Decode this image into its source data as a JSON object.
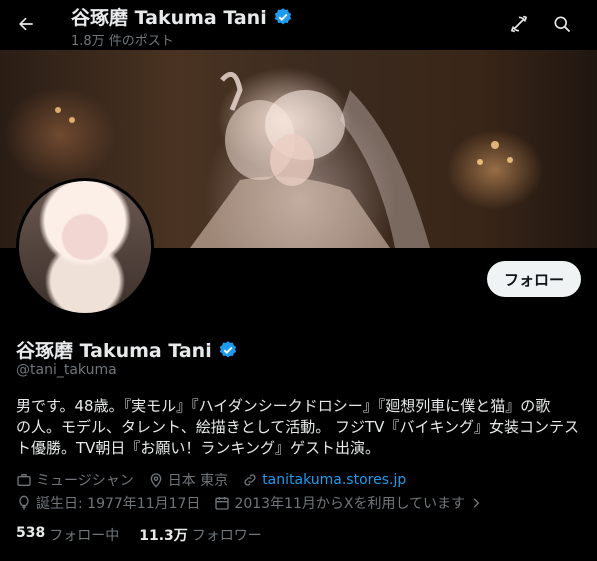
{
  "header": {
    "name": "谷琢磨 Takuma Tani",
    "post_count": "1.8万 件のポスト"
  },
  "profile": {
    "name": "谷琢磨 Takuma Tani",
    "handle": "@tani_takuma",
    "follow_label": "フォロー",
    "bio_lines": [
      "男です。48歳。『実モル』『ハイダンシークドロシー』『廻想列車に僕と猫』の歌",
      "の人。モデル、タレント、絵描きとして活動。 フジTV『バイキング』女装コンテス",
      "ト優勝。TV朝日『お願い！ランキング』ゲスト出演。"
    ],
    "category": "ミュージシャン",
    "location": "日本 東京",
    "website": "tanitakuma.stores.jp",
    "birthday": "誕生日: 1977年11月17日",
    "joined": "2013年11月からXを利用しています",
    "following_count": "538",
    "following_label": "フォロー中",
    "followers_count": "11.3万",
    "followers_label": "フォロワー"
  },
  "colors": {
    "background": "#000000",
    "text": "#e7e9ea",
    "muted": "#71767b",
    "link": "#1d9bf0",
    "verified": "#1d9bf0"
  }
}
